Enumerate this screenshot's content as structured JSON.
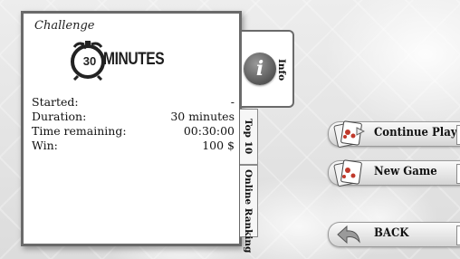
{
  "challenge": {
    "prefix": "Challenge",
    "clock_number": "30",
    "title": "MINUTES"
  },
  "stats": [
    {
      "label": "Started:",
      "value": "-"
    },
    {
      "label": "Duration:",
      "value": "30 minutes"
    },
    {
      "label": "Time remaining:",
      "value": "00:30:00"
    },
    {
      "label": "Win:",
      "value": "100 $"
    }
  ],
  "tabs": {
    "info": "Info",
    "top10": "Top 10",
    "online": "Online Ranking"
  },
  "buttons": {
    "continue": "Continue Playing",
    "new_game": "New Game",
    "back": "BACK"
  },
  "icons": {
    "info": "info-icon",
    "clock": "alarm-clock-icon",
    "cards": "playing-cards-icon",
    "back": "back-arrow-icon"
  },
  "info_glyph": "i"
}
